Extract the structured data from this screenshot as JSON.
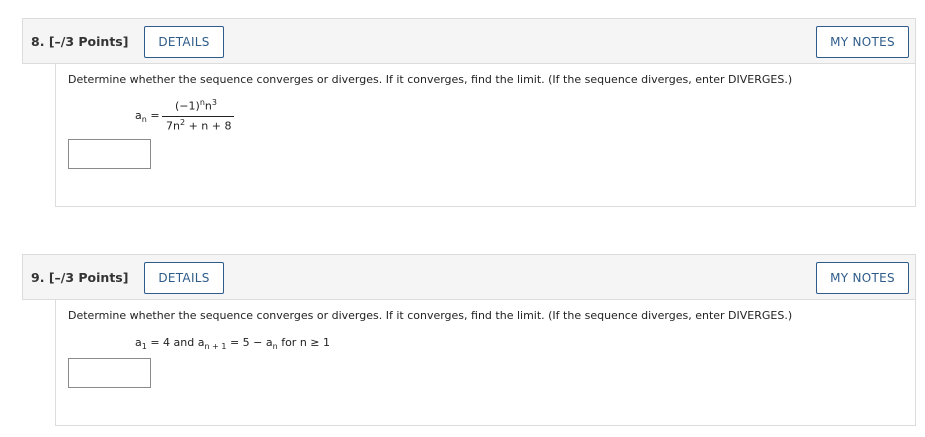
{
  "questions": [
    {
      "number_label": "8.",
      "points_label": "[–/3 Points]",
      "details_label": "DETAILS",
      "notes_label": "MY NOTES",
      "prompt": "Determine whether the sequence converges or diverges. If it converges, find the limit. (If the sequence diverges, enter DIVERGES.)",
      "formula": {
        "lhs": "a",
        "lhs_sub": "n",
        "eq": "=",
        "numerator": "(−1)",
        "numerator_exp": "n",
        "numerator_var": "n",
        "numerator_var_exp": "3",
        "denominator_coef": "7n",
        "denominator_exp": "2",
        "denominator_rest": " + n + 8"
      },
      "answer_value": ""
    },
    {
      "number_label": "9.",
      "points_label": "[–/3 Points]",
      "details_label": "DETAILS",
      "notes_label": "MY NOTES",
      "prompt": "Determine whether the sequence converges or diverges. If it converges, find the limit. (If the sequence diverges, enter DIVERGES.)",
      "formula": {
        "a1": "a",
        "a1_sub": "1",
        "part1": " = 4 and ",
        "an1": "a",
        "an1_sub": "n + 1",
        "part2": " = 5 − ",
        "an": "a",
        "an_sub": "n",
        "part3": " for n ≥ 1"
      },
      "answer_value": ""
    }
  ]
}
